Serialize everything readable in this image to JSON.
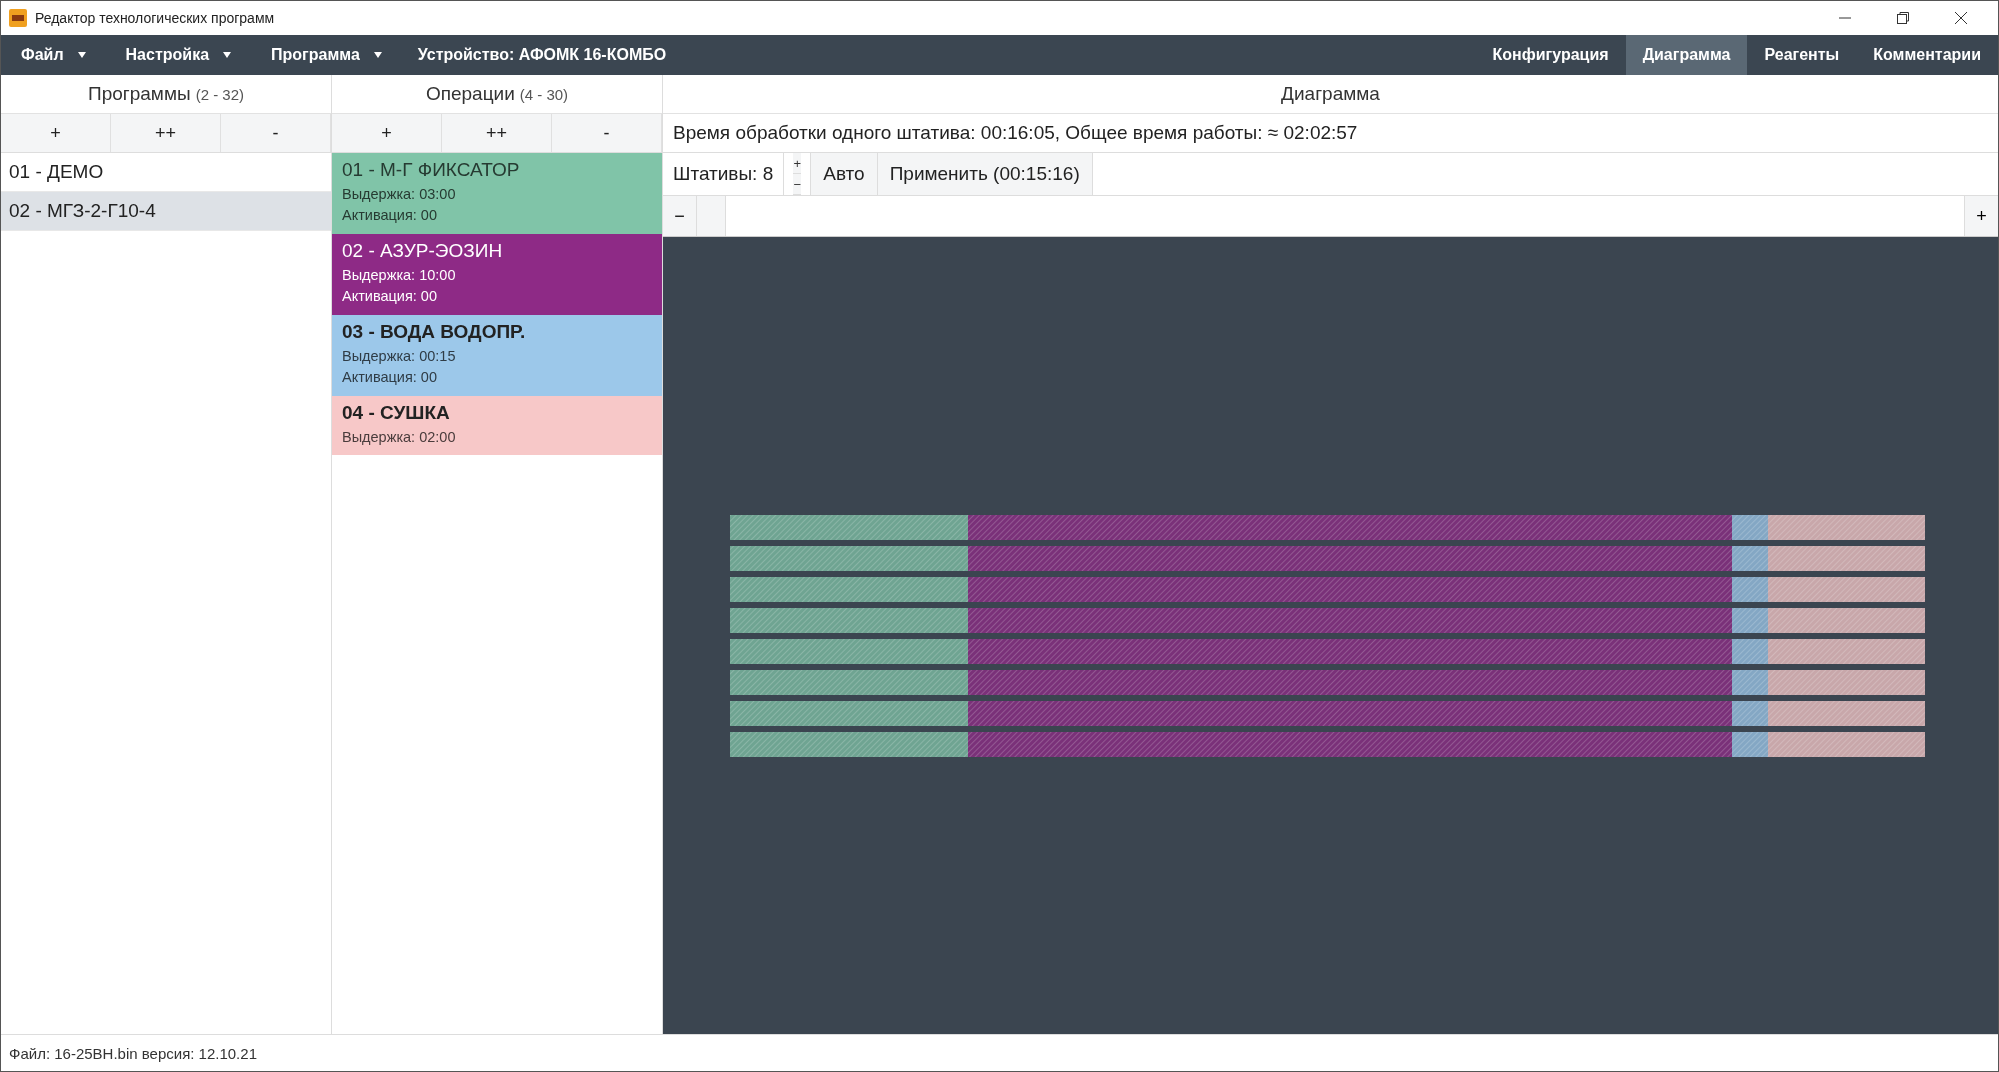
{
  "window": {
    "title": "Редактор технологических программ"
  },
  "menu": [
    {
      "label": "Файл"
    },
    {
      "label": "Настройка"
    },
    {
      "label": "Программа"
    }
  ],
  "device": "Устройство: АФОМК 16-КОМБО",
  "tabs": [
    {
      "label": "Конфигурация",
      "selected": false
    },
    {
      "label": "Диаграмма",
      "selected": true
    },
    {
      "label": "Реагенты",
      "selected": false
    },
    {
      "label": "Комментарии",
      "selected": false
    }
  ],
  "programs": {
    "title": "Программы",
    "range": "(2 - 32)",
    "buttons": [
      "+",
      "++",
      "-"
    ],
    "items": [
      {
        "label": "01 - ДЕМО",
        "selected": false
      },
      {
        "label": "02 - МГЗ-2-Г10-4",
        "selected": true
      }
    ]
  },
  "operations": {
    "title": "Операции",
    "range": "(4 - 30)",
    "buttons": [
      "+",
      "++",
      "-"
    ],
    "items": [
      {
        "name": "01 - М-Г ФИКСАТОР",
        "bold": false,
        "color": "#80c4a8",
        "details": [
          "Выдержка: 03:00",
          "Активация: 00"
        ]
      },
      {
        "name": "02 - АЗУР-ЭОЗИН",
        "bold": false,
        "color": "#8e2a86",
        "details": [
          "Выдержка: 10:00",
          "Активация: 00"
        ]
      },
      {
        "name": "03 - ВОДА ВОДОПР.",
        "bold": true,
        "color": "#9cc8ea",
        "details": [
          "Выдержка: 00:15",
          "Активация: 00"
        ]
      },
      {
        "name": "04 - СУШКА",
        "bold": true,
        "color": "#f7c8c8",
        "details": [
          "Выдержка: 02:00"
        ]
      }
    ]
  },
  "diagram": {
    "title": "Диаграмма",
    "info": "Время обработки одного штатива: 00:16:05, Общее время работы: ≈ 02:02:57",
    "racks": "Штативы: 8",
    "up": "+",
    "down": "−",
    "auto": "Авто",
    "apply": "Применить (00:15:16)",
    "zoom_out": "−",
    "zoom_in": "+"
  },
  "status_bar": "Файл: 16-25BH.bin версия: 12.10.21"
}
